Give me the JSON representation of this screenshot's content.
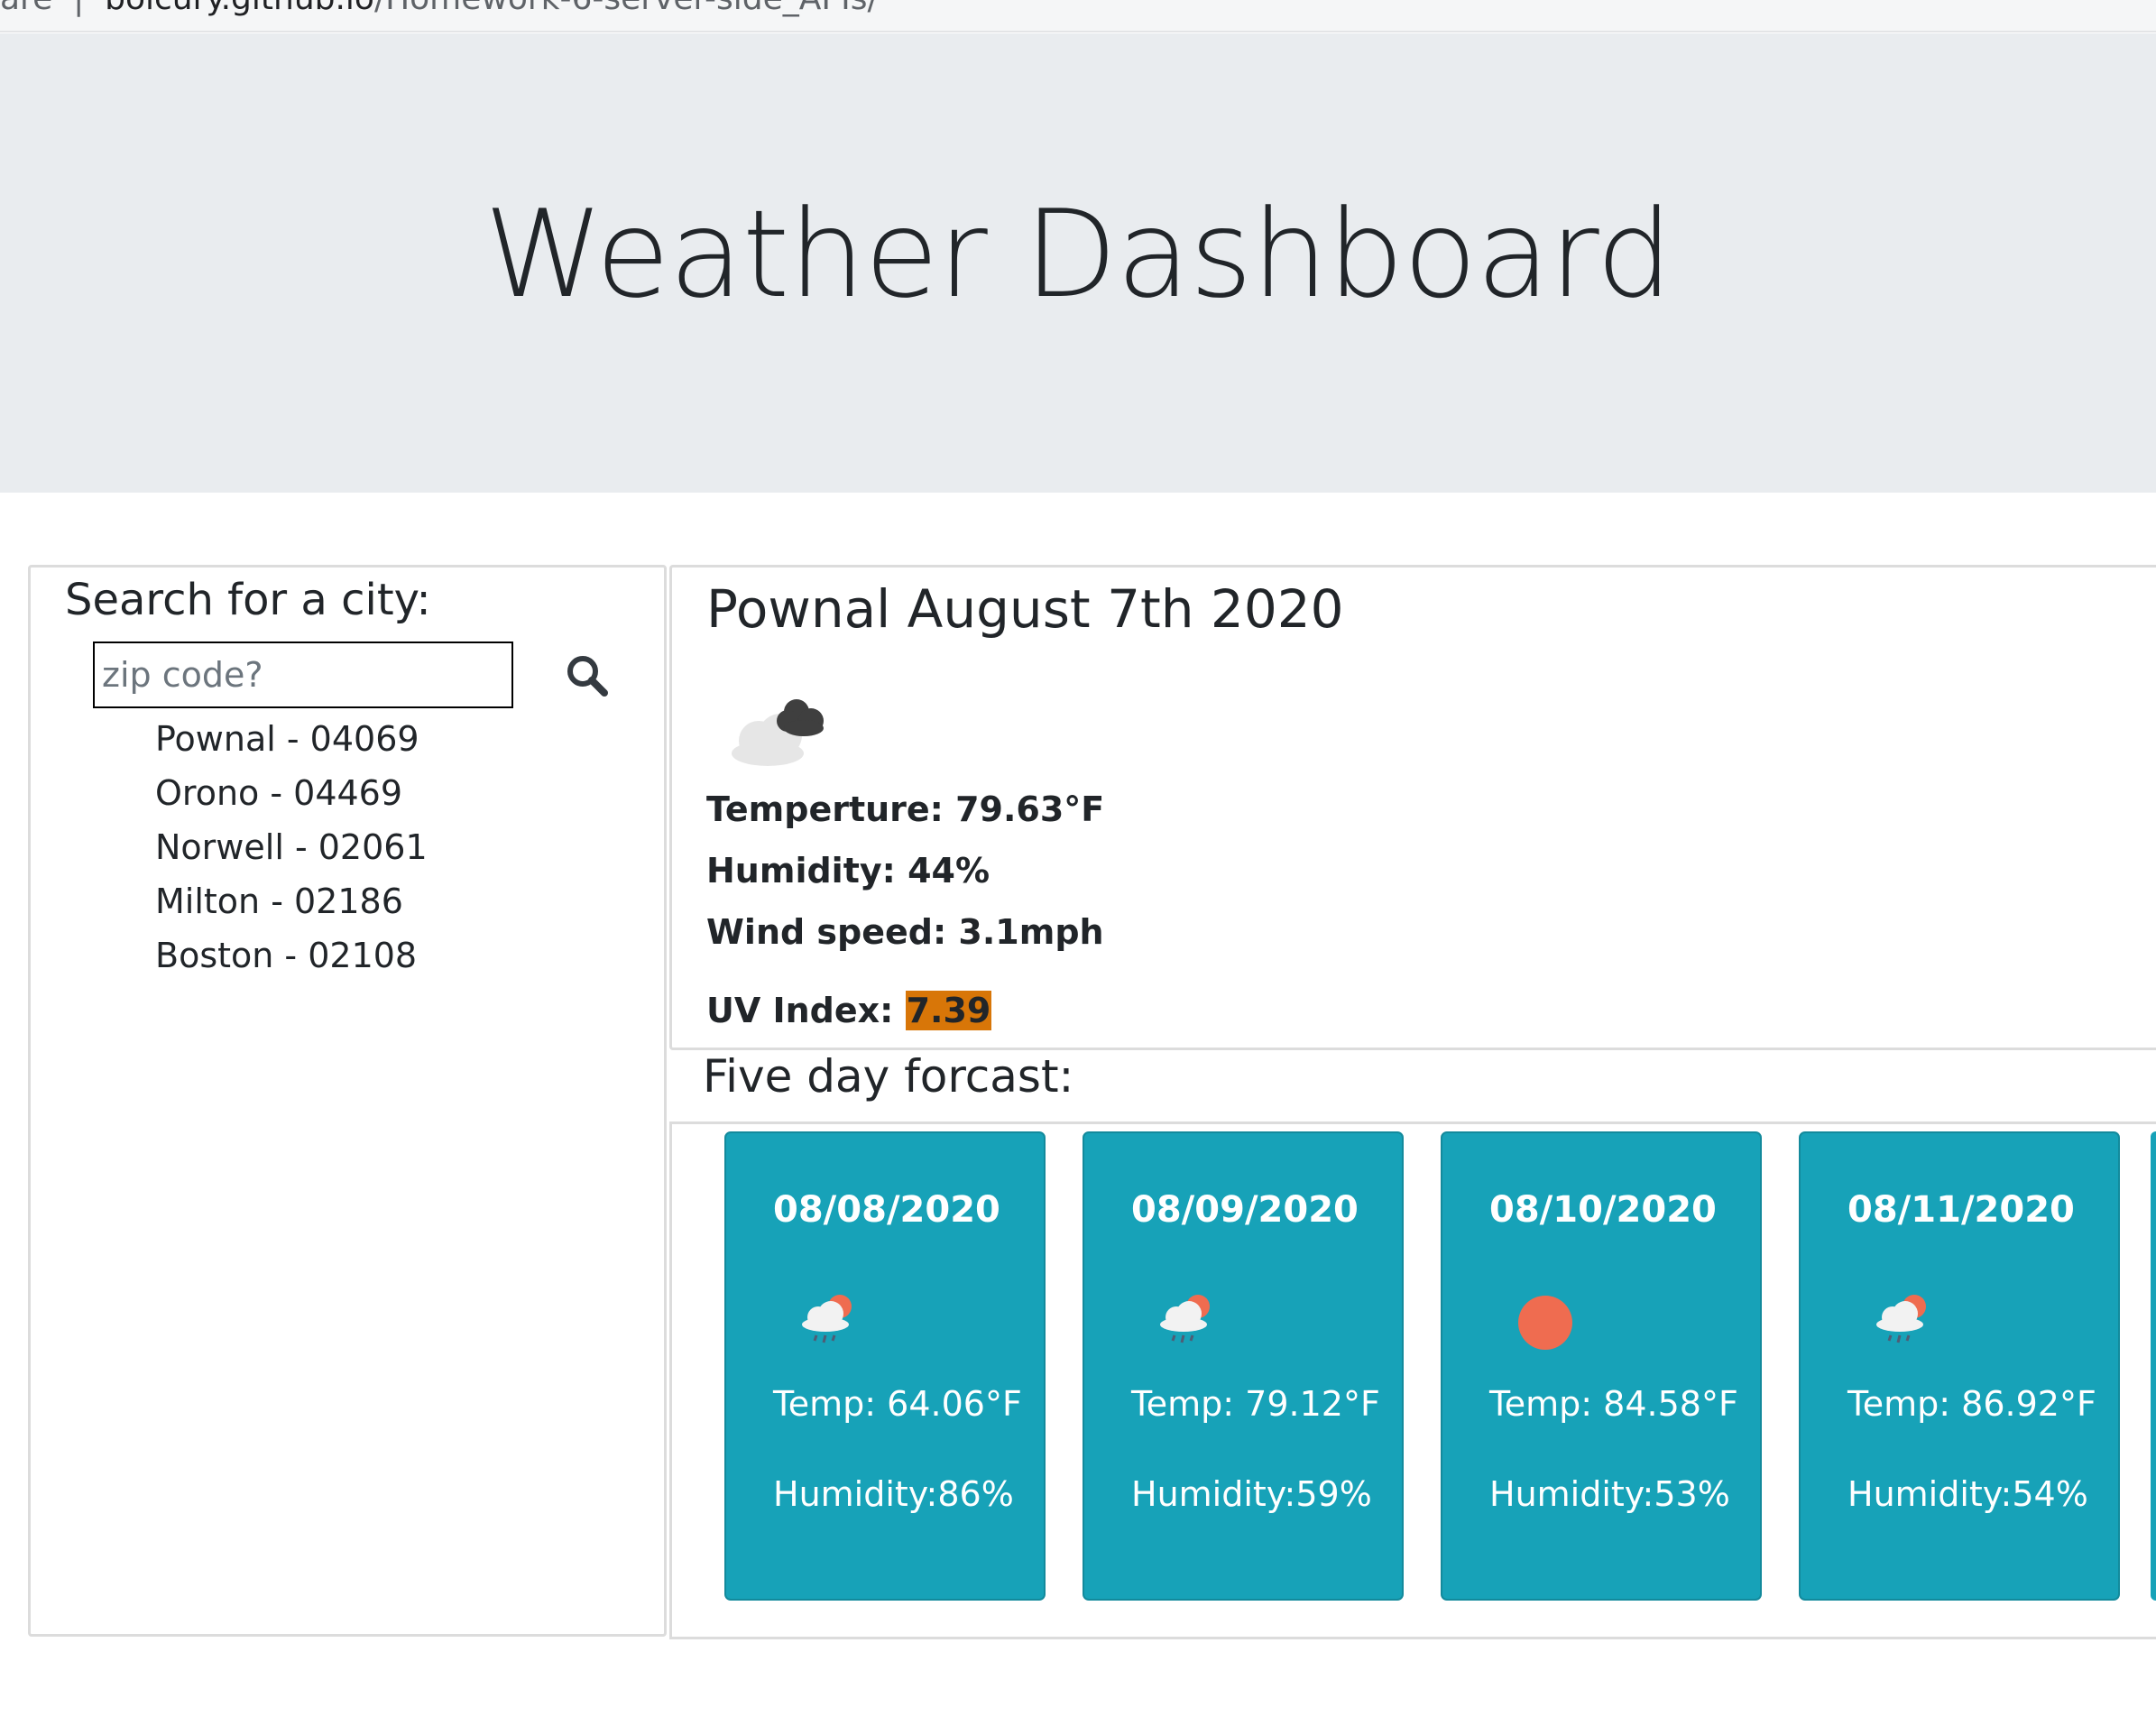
{
  "browser": {
    "url_prefix": "are",
    "url_host": "bolcury.github.io",
    "url_path": "/Homework-6-server-side_APIs/"
  },
  "header": {
    "title": "Weather Dashboard"
  },
  "search": {
    "heading": "Search for a city:",
    "placeholder": "zip code?",
    "value": "",
    "history": [
      "Pownal - 04069",
      "Orono - 04469",
      "Norwell - 02061",
      "Milton - 02186",
      "Boston - 02108"
    ]
  },
  "current": {
    "title": "Pownal August 7th 2020",
    "icon": "broken-clouds-icon",
    "temperature": "Temperture: 79.63°F",
    "humidity": "Humidity: 44%",
    "wind": "Wind speed: 3.1mph",
    "uv_label": "UV Index: ",
    "uv_value": "7.39",
    "uv_color": "#d87608"
  },
  "forecast": {
    "heading": "Five day forcast:",
    "card_color": "#17a2b8",
    "days": [
      {
        "date": "08/08/2020",
        "icon": "rain-sun-icon",
        "temp": "Temp: 64.06°F",
        "humidity": "Humidity:86%"
      },
      {
        "date": "08/09/2020",
        "icon": "rain-sun-icon",
        "temp": "Temp: 79.12°F",
        "humidity": "Humidity:59%"
      },
      {
        "date": "08/10/2020",
        "icon": "sun-icon",
        "temp": "Temp: 84.58°F",
        "humidity": "Humidity:53%"
      },
      {
        "date": "08/11/2020",
        "icon": "rain-sun-icon",
        "temp": "Temp: 86.92°F",
        "humidity": "Humidity:54%"
      }
    ]
  }
}
